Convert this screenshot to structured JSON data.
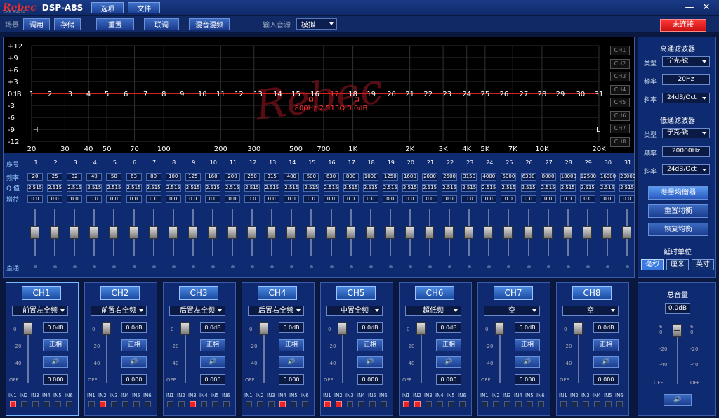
{
  "titlebar": {
    "logo": "Rebec",
    "logo_sub": "CAR AUDIO",
    "app_title": "DSP-A8S",
    "menu": [
      "选项",
      "文件"
    ],
    "minimize": "—",
    "close": "✕"
  },
  "toolbar": {
    "scene_label": "场景",
    "load": "调用",
    "save": "存储",
    "reset": "重置",
    "link": "联调",
    "mix": "混音混频",
    "source_label": "输入音源",
    "source_value": "模拟",
    "connect": "未连接"
  },
  "graph": {
    "y_ticks": [
      "+12",
      "+9",
      "+6",
      "+3",
      "0dB",
      "-3",
      "-6",
      "-9",
      "-12"
    ],
    "x_ticks": [
      "20",
      "30",
      "40",
      "50",
      "70",
      "100",
      "200",
      "300",
      "500",
      "700",
      "1K",
      "2K",
      "3K",
      "4K",
      "5K",
      "7K",
      "10K",
      "20K"
    ],
    "x_tick_freqs": [
      20,
      30,
      40,
      50,
      70,
      100,
      200,
      300,
      500,
      700,
      1000,
      2000,
      3000,
      4000,
      5000,
      7000,
      10000,
      20000
    ],
    "band_markers": [
      "1",
      "2",
      "3",
      "4",
      "5",
      "6",
      "7",
      "8",
      "9",
      "10",
      "11",
      "12",
      "13",
      "14",
      "15",
      "16",
      "17",
      "18",
      "19",
      "20",
      "21",
      "22",
      "23",
      "24",
      "25",
      "26",
      "27",
      "28",
      "29",
      "30",
      "31"
    ],
    "band_marker_freqs": [
      20,
      25,
      32,
      40,
      50,
      63,
      80,
      100,
      125,
      160,
      200,
      250,
      315,
      400,
      500,
      630,
      800,
      1000,
      1250,
      1600,
      2000,
      2500,
      3150,
      4000,
      5000,
      6300,
      8000,
      10000,
      12500,
      16000,
      20000
    ],
    "selected_band": "17",
    "info": "800Hz 2.515Q 0.0dB",
    "hp_marker": "H",
    "lp_marker": "L",
    "watermark": "Rebec",
    "channels": [
      "CH1",
      "CH2",
      "CH3",
      "CH4",
      "CH5",
      "CH6",
      "CH7",
      "CH8"
    ]
  },
  "eq_table": {
    "labels": {
      "index": "序号",
      "freq": "频率",
      "q": "Q 值",
      "gain": "增益",
      "bypass": "直通"
    },
    "index": [
      "1",
      "2",
      "3",
      "4",
      "5",
      "6",
      "7",
      "8",
      "9",
      "10",
      "11",
      "12",
      "13",
      "14",
      "15",
      "16",
      "17",
      "18",
      "19",
      "20",
      "21",
      "22",
      "23",
      "24",
      "25",
      "26",
      "27",
      "28",
      "29",
      "30",
      "31"
    ],
    "freq": [
      "20",
      "25",
      "32",
      "40",
      "50",
      "63",
      "80",
      "100",
      "125",
      "160",
      "200",
      "250",
      "315",
      "400",
      "500",
      "630",
      "800",
      "1000",
      "1250",
      "1600",
      "2000",
      "2500",
      "3150",
      "4000",
      "5000",
      "6300",
      "8000",
      "10000",
      "12500",
      "16000",
      "20000"
    ],
    "q": "2.515",
    "gain": "0.0",
    "gain_db": 0,
    "gain_range": [
      -12,
      12
    ]
  },
  "hpf": {
    "title": "高通滤波器",
    "type_label": "类型",
    "type": "宁克-锐",
    "freq_label": "频率",
    "freq": "20Hz",
    "slope_label": "斜率",
    "slope": "24dB/Oct"
  },
  "lpf": {
    "title": "低通滤波器",
    "type_label": "类型",
    "type": "宁克-锐",
    "freq_label": "频率",
    "freq": "20000Hz",
    "slope_label": "斜率",
    "slope": "24dB/Oct"
  },
  "eq_actions": {
    "param": "参量均衡器",
    "reset": "重置均衡",
    "restore": "恢复均衡"
  },
  "delay": {
    "title": "延时单位",
    "units": [
      "毫秒",
      "厘米",
      "英寸"
    ],
    "selected": 0
  },
  "channel_strip": {
    "scale": [
      "0",
      "-20",
      "-40",
      "OFF"
    ],
    "inputs": [
      "IN1",
      "IN2",
      "IN3",
      "IN4",
      "IN5",
      "IN6"
    ],
    "phase": "正相",
    "mute": "🔊",
    "channels": [
      {
        "name": "CH1",
        "source": "前置左全频",
        "gain": "0.0dB",
        "delay": "0.000",
        "active": [
          true,
          false,
          false,
          false,
          false,
          false
        ]
      },
      {
        "name": "CH2",
        "source": "前置右全频",
        "gain": "0.0dB",
        "delay": "0.000",
        "active": [
          false,
          true,
          false,
          false,
          false,
          false
        ]
      },
      {
        "name": "CH3",
        "source": "后置左全频",
        "gain": "0.0dB",
        "delay": "0.000",
        "active": [
          false,
          false,
          true,
          false,
          false,
          false
        ]
      },
      {
        "name": "CH4",
        "source": "后置右全频",
        "gain": "0.0dB",
        "delay": "0.000",
        "active": [
          false,
          false,
          false,
          true,
          false,
          false
        ]
      },
      {
        "name": "CH5",
        "source": "中置全频",
        "gain": "0.0dB",
        "delay": "0.000",
        "active": [
          true,
          true,
          false,
          false,
          false,
          false
        ]
      },
      {
        "name": "CH6",
        "source": "超低频",
        "gain": "0.0dB",
        "delay": "0.000",
        "active": [
          true,
          true,
          false,
          false,
          false,
          false
        ]
      },
      {
        "name": "CH7",
        "source": "空",
        "gain": "0.0dB",
        "delay": "0.000",
        "active": [
          false,
          false,
          false,
          false,
          false,
          false
        ]
      },
      {
        "name": "CH8",
        "source": "空",
        "gain": "0.0dB",
        "delay": "0.000",
        "active": [
          false,
          false,
          false,
          false,
          false,
          false
        ]
      }
    ]
  },
  "master": {
    "title": "总音量",
    "value": "0.0dB",
    "scale": [
      "6",
      "0",
      "-20",
      "-40",
      "OFF"
    ],
    "mute": "🔊"
  }
}
